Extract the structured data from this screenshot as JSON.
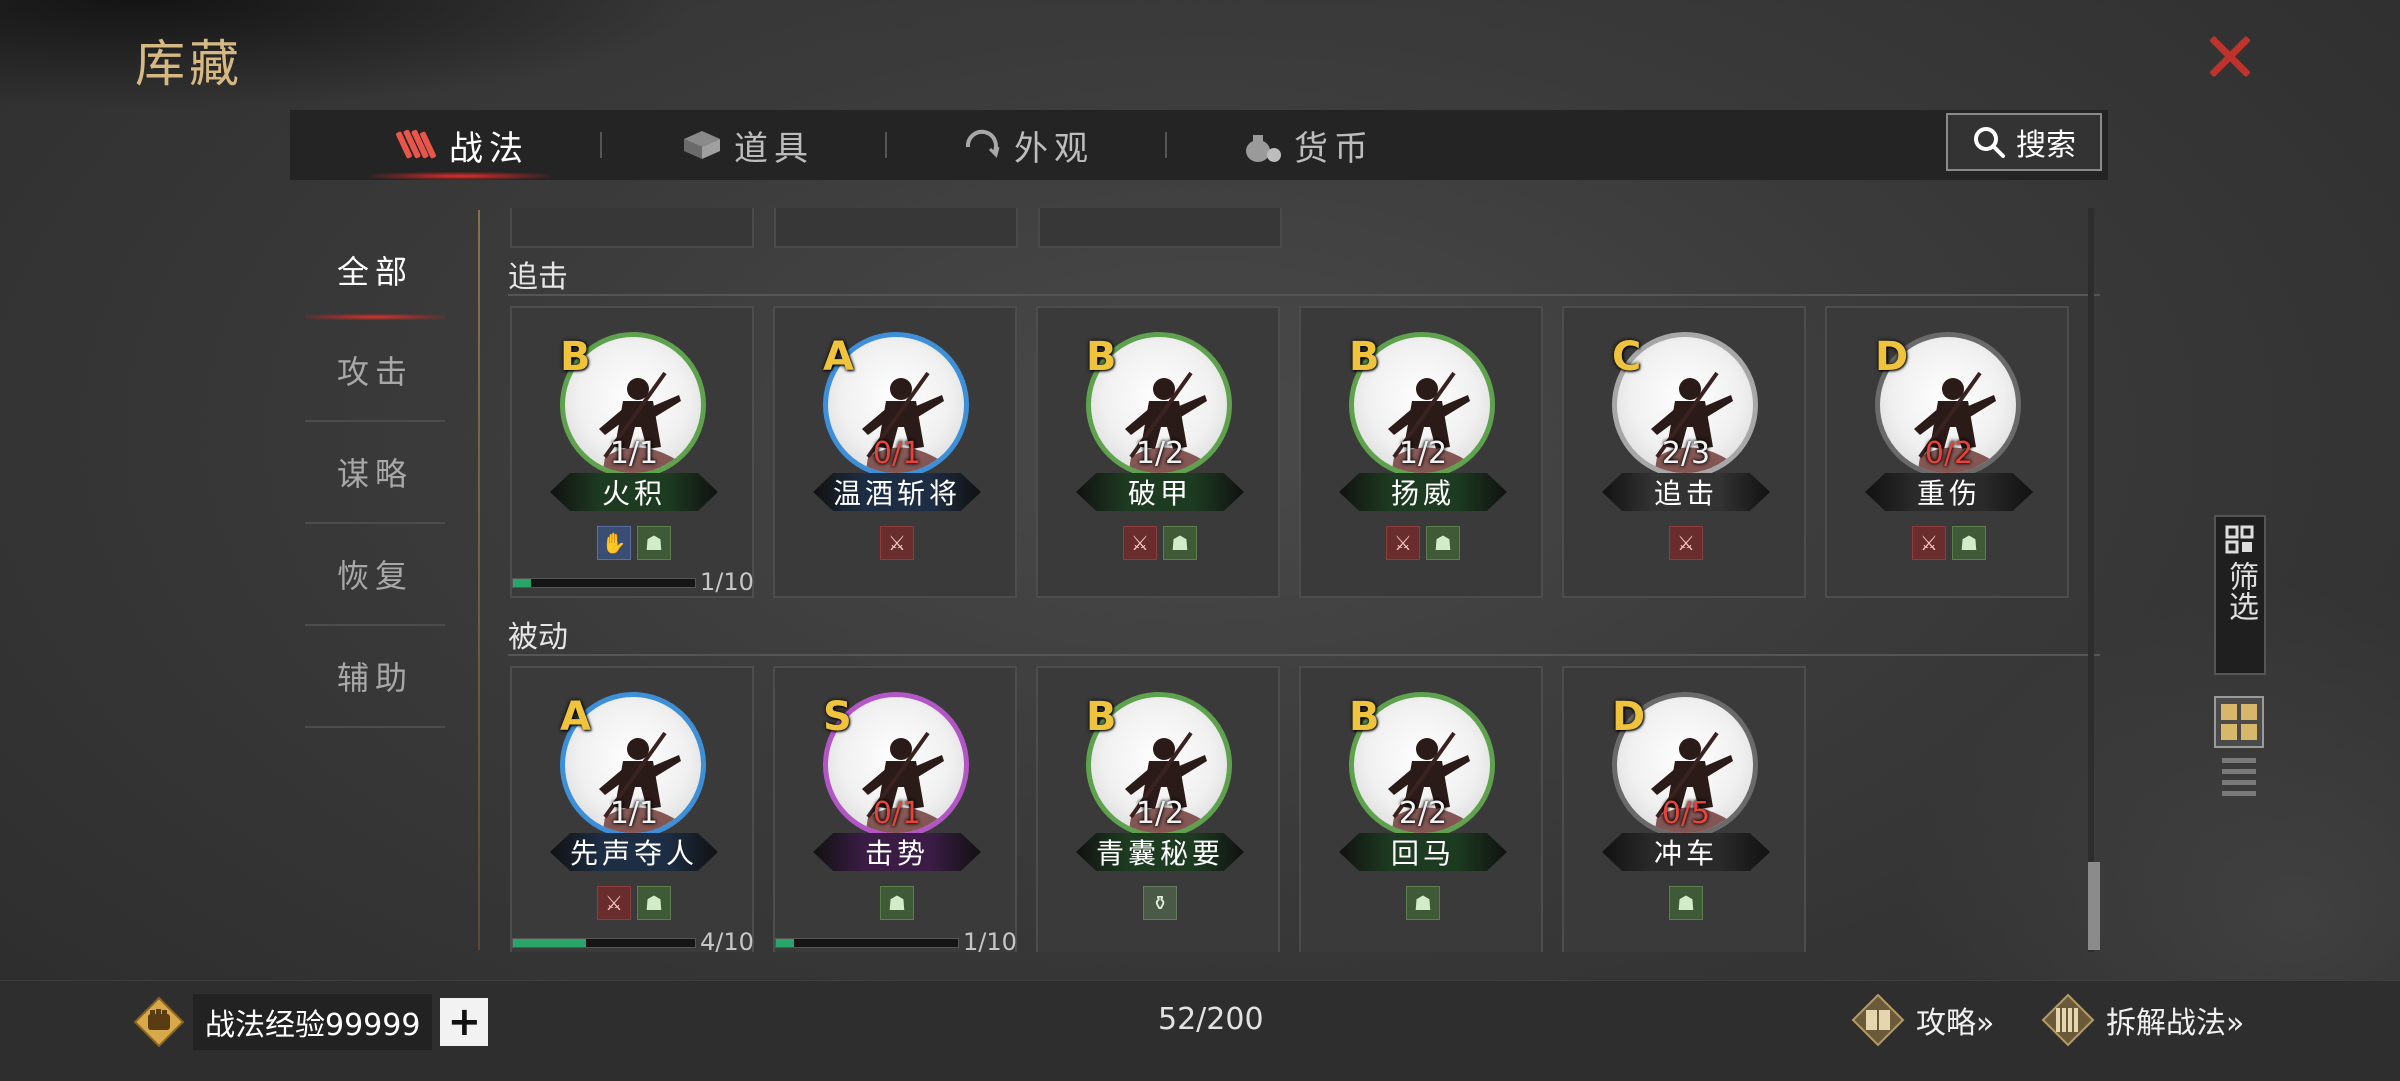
{
  "window": {
    "title": "库藏",
    "close_icon": "close-icon"
  },
  "tabs": [
    {
      "label": "战法",
      "icon": "scroll-bundle-icon",
      "active": true
    },
    {
      "label": "道具",
      "icon": "chest-icon",
      "active": false
    },
    {
      "label": "外观",
      "icon": "swirl-icon",
      "active": false
    },
    {
      "label": "货币",
      "icon": "money-bag-icon",
      "active": false
    }
  ],
  "search": {
    "label": "搜索",
    "icon": "search-icon"
  },
  "sidebar": {
    "items": [
      {
        "label": "全部",
        "active": true
      },
      {
        "label": "攻击",
        "active": false
      },
      {
        "label": "谋略",
        "active": false
      },
      {
        "label": "恢复",
        "active": false
      },
      {
        "label": "辅助",
        "active": false
      }
    ]
  },
  "sections": [
    {
      "title": "追击",
      "cards": [
        {
          "grade": "B",
          "count": "1/1",
          "count_red": false,
          "name": "火积",
          "ring": "#5fa24e",
          "banner": "#1d3b21",
          "tags": [
            "ctrl",
            "heal"
          ],
          "progress": {
            "fraction": 0.1,
            "text": "1/10"
          }
        },
        {
          "grade": "A",
          "count": "0/1",
          "count_red": true,
          "name": "温酒斩将",
          "ring": "#3d8fd8",
          "banner": "#1d2d44",
          "tags": [
            "atk"
          ]
        },
        {
          "grade": "B",
          "count": "1/2",
          "count_red": false,
          "name": "破甲",
          "ring": "#5fa24e",
          "banner": "#1d3b21",
          "tags": [
            "atk",
            "heal"
          ]
        },
        {
          "grade": "B",
          "count": "1/2",
          "count_red": false,
          "name": "扬威",
          "ring": "#5fa24e",
          "banner": "#1d3b21",
          "tags": [
            "atk",
            "heal"
          ]
        },
        {
          "grade": "C",
          "count": "2/3",
          "count_red": false,
          "name": "追击",
          "ring": "#a7a7a7",
          "banner": "#333333",
          "tags": [
            "atk"
          ]
        },
        {
          "grade": "D",
          "count": "0/2",
          "count_red": true,
          "name": "重伤",
          "ring": "#6a6a6a",
          "banner": "#2a2a2a",
          "tags": [
            "atk",
            "heal"
          ]
        }
      ]
    },
    {
      "title": "被动",
      "cards": [
        {
          "grade": "A",
          "count": "1/1",
          "count_red": false,
          "name": "先声夺人",
          "ring": "#3d8fd8",
          "banner": "#1d2d44",
          "tags": [
            "atk",
            "heal"
          ],
          "progress": {
            "fraction": 0.4,
            "text": "4/10"
          }
        },
        {
          "grade": "S",
          "count": "0/1",
          "count_red": true,
          "name": "击势",
          "ring": "#b256c6",
          "banner": "#3a1c44",
          "tags": [
            "heal"
          ],
          "progress": {
            "fraction": 0.1,
            "text": "1/10"
          }
        },
        {
          "grade": "B",
          "count": "1/2",
          "count_red": false,
          "name": "青囊秘要",
          "ring": "#5fa24e",
          "banner": "#1d3b21",
          "tags": [
            "spec"
          ]
        },
        {
          "grade": "B",
          "count": "2/2",
          "count_red": false,
          "name": "回马",
          "ring": "#5fa24e",
          "banner": "#1d3b21",
          "tags": [
            "heal"
          ]
        },
        {
          "grade": "D",
          "count": "0/5",
          "count_red": true,
          "name": "冲车",
          "ring": "#6a6a6a",
          "banner": "#2a2a2a",
          "tags": [
            "heal"
          ]
        }
      ]
    }
  ],
  "filter": {
    "label": "筛选",
    "icon": "filter-grid-icon"
  },
  "view_toggle": {
    "grid_icon": "grid-view-icon",
    "list_icon": "list-view-icon",
    "active": "grid"
  },
  "footer": {
    "exp_label": "战法经验99999",
    "exp_icon": "fist-badge-icon",
    "add_label": "+",
    "capacity": "52/200",
    "guide_label": "攻略»",
    "guide_icon": "book-icon",
    "dismantle_label": "拆解战法»",
    "dismantle_icon": "bamboo-scroll-icon"
  },
  "colors": {
    "accent_gold": "#d6b882",
    "close_red": "#c0322c",
    "progress_green": "#29a56a",
    "grade_yellow": "#f0c33c"
  }
}
